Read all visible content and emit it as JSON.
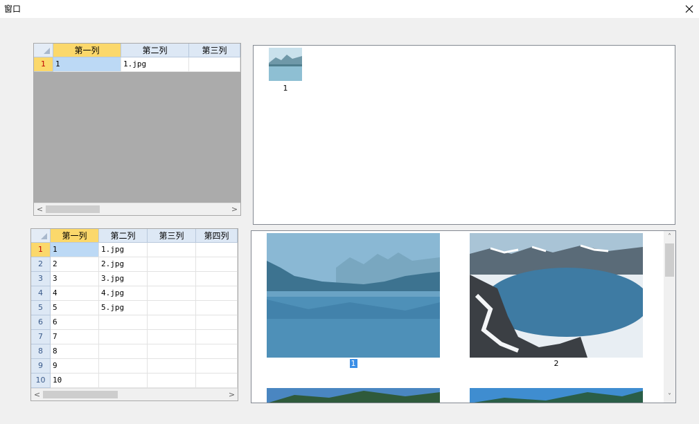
{
  "window": {
    "title": "窗口",
    "close_label": "×"
  },
  "grid_top": {
    "columns": [
      "第一列",
      "第二列",
      "第三列"
    ],
    "rows": [
      {
        "num": "1",
        "cells": [
          "1",
          "1.jpg",
          ""
        ]
      }
    ]
  },
  "grid_bottom": {
    "columns": [
      "第一列",
      "第二列",
      "第三列",
      "第四列"
    ],
    "rows": [
      {
        "num": "1",
        "cells": [
          "1",
          "1.jpg",
          "",
          ""
        ]
      },
      {
        "num": "2",
        "cells": [
          "2",
          "2.jpg",
          "",
          ""
        ]
      },
      {
        "num": "3",
        "cells": [
          "3",
          "3.jpg",
          "",
          ""
        ]
      },
      {
        "num": "4",
        "cells": [
          "4",
          "4.jpg",
          "",
          ""
        ]
      },
      {
        "num": "5",
        "cells": [
          "5",
          "5.jpg",
          "",
          ""
        ]
      },
      {
        "num": "6",
        "cells": [
          "6",
          "",
          "",
          ""
        ]
      },
      {
        "num": "7",
        "cells": [
          "7",
          "",
          "",
          ""
        ]
      },
      {
        "num": "8",
        "cells": [
          "8",
          "",
          "",
          ""
        ]
      },
      {
        "num": "9",
        "cells": [
          "9",
          "",
          "",
          ""
        ]
      },
      {
        "num": "10",
        "cells": [
          "10",
          "",
          "",
          ""
        ]
      }
    ]
  },
  "preview_top": {
    "items": [
      {
        "label": "1"
      }
    ]
  },
  "preview_bottom": {
    "items": [
      {
        "label": "1",
        "selected": true
      },
      {
        "label": "2",
        "selected": false
      }
    ]
  },
  "scroll_arrows": {
    "left": "<",
    "right": ">",
    "up": "˄",
    "down": "˅"
  },
  "colors": {
    "header_bg": "#dde8f5",
    "selected_header": "#fbd86b",
    "selected_cell": "#bcd9f5",
    "grid_empty": "#ababab",
    "selection_label": "#3a8ee6"
  }
}
